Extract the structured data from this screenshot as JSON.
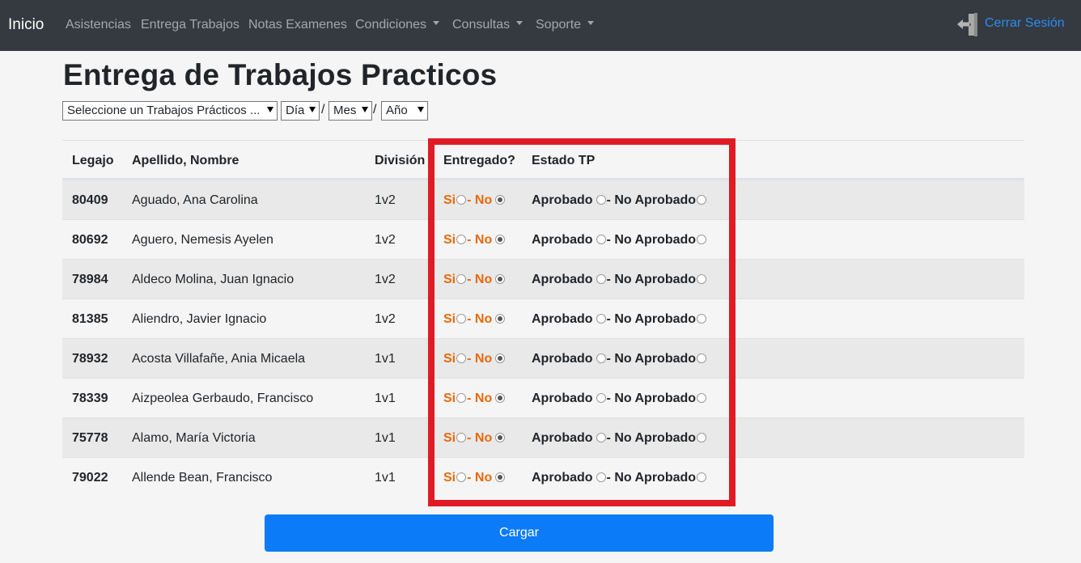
{
  "navbar": {
    "brand": "Inicio",
    "links": [
      {
        "label": "Asistencias"
      },
      {
        "label": "Entrega Trabajos"
      },
      {
        "label": "Notas Examenes"
      },
      {
        "label": "Condiciones"
      },
      {
        "label": "Consultas"
      },
      {
        "label": "Soporte"
      }
    ],
    "logout_label": "Cerrar Sesión",
    "logout_icon": "logout-door-icon"
  },
  "page": {
    "title": "Entrega de Trabajos Practicos"
  },
  "filters": {
    "tp_select": "Seleccione un Trabajos Prácticos ...",
    "day_select": "Día",
    "month_select": "Mes",
    "year_select": "Año",
    "separator": "/"
  },
  "table": {
    "headers": [
      "Legajo",
      "Apellido, Nombre",
      "División",
      "Entregado?",
      "Estado TP"
    ],
    "options": {
      "si": "Si",
      "dash_no": "- No",
      "aprobado": "Aprobado",
      "dash_no_aprobado": "- No Aprobado"
    },
    "rows": [
      {
        "legajo": "80409",
        "nombre": "Aguado, Ana Carolina",
        "division": "1v2",
        "entregado": "no",
        "estado": "none"
      },
      {
        "legajo": "80692",
        "nombre": "Aguero, Nemesis Ayelen",
        "division": "1v2",
        "entregado": "no",
        "estado": "none"
      },
      {
        "legajo": "78984",
        "nombre": "Aldeco Molina, Juan Ignacio",
        "division": "1v2",
        "entregado": "no",
        "estado": "none"
      },
      {
        "legajo": "81385",
        "nombre": "Aliendro, Javier Ignacio",
        "division": "1v2",
        "entregado": "no",
        "estado": "none"
      },
      {
        "legajo": "78932",
        "nombre": "Acosta Villafañe, Ania Micaela",
        "division": "1v1",
        "entregado": "no",
        "estado": "none"
      },
      {
        "legajo": "78339",
        "nombre": "Aizpeolea Gerbaudo, Francisco",
        "division": "1v1",
        "entregado": "no",
        "estado": "none"
      },
      {
        "legajo": "75778",
        "nombre": "Alamo, María Victoria",
        "division": "1v1",
        "entregado": "no",
        "estado": "none"
      },
      {
        "legajo": "79022",
        "nombre": "Allende Bean, Francisco",
        "division": "1v1",
        "entregado": "no",
        "estado": "none"
      }
    ]
  },
  "submit": {
    "label": "Cargar"
  },
  "colors": {
    "navbar_bg": "#343a40",
    "accent_orange": "#e8690b",
    "button_blue": "#0b7bf7",
    "highlight_red": "#e01b24",
    "link_blue": "#2b8cf0"
  }
}
